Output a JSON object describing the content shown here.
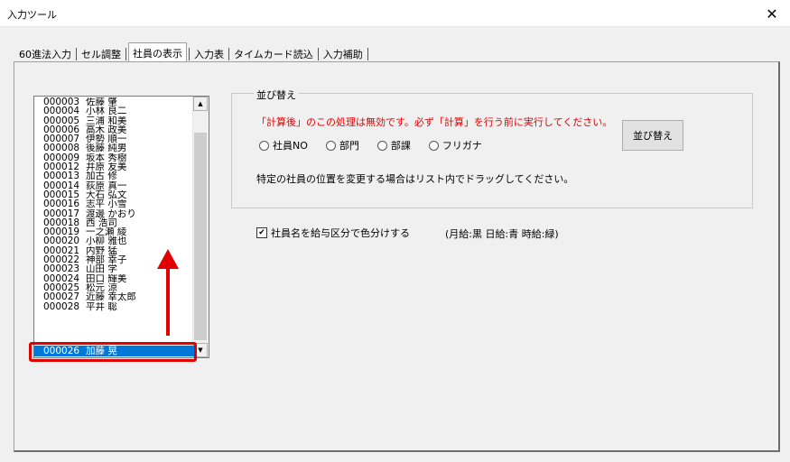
{
  "window": {
    "title": "入力ツール",
    "close_label": "✕"
  },
  "tabs": [
    "60進法入力",
    "セル調整",
    "社員の表示",
    "入力表",
    "タイムカード読込",
    "入力補助"
  ],
  "active_tab": "社員の表示",
  "employee_list": [
    {
      "code": "000003",
      "name": "佐藤 肇"
    },
    {
      "code": "000004",
      "name": "小林 良二"
    },
    {
      "code": "000005",
      "name": "三浦 和美"
    },
    {
      "code": "000006",
      "name": "高木 政美"
    },
    {
      "code": "000007",
      "name": "伊勢 順一"
    },
    {
      "code": "000008",
      "name": "後藤 純男"
    },
    {
      "code": "000009",
      "name": "坂本 秀樹"
    },
    {
      "code": "000012",
      "name": "井原 友美"
    },
    {
      "code": "000013",
      "name": "加古 修"
    },
    {
      "code": "000014",
      "name": "荻原 真一"
    },
    {
      "code": "000015",
      "name": "大石 弘文"
    },
    {
      "code": "000016",
      "name": "志平 小雪"
    },
    {
      "code": "000017",
      "name": "渡邊 かおり"
    },
    {
      "code": "000018",
      "name": "西 浩司"
    },
    {
      "code": "000019",
      "name": "一之瀬 綾"
    },
    {
      "code": "000020",
      "name": "小柳 雅也"
    },
    {
      "code": "000021",
      "name": "内野 猛"
    },
    {
      "code": "000022",
      "name": "神部 幸子"
    },
    {
      "code": "000023",
      "name": "山田 学"
    },
    {
      "code": "000024",
      "name": "田口 輝美"
    },
    {
      "code": "000025",
      "name": "松元 涼"
    },
    {
      "code": "000027",
      "name": "近藤 幸太郎"
    },
    {
      "code": "000028",
      "name": "平井 聡"
    }
  ],
  "selected_item": {
    "code": "000026",
    "name": "加藤 晃"
  },
  "sort_group": {
    "label": "並び替え",
    "warning": "「計算後」のこの処理は無効です。必ず「計算」を行う前に実行してください。",
    "options": [
      "社員NO",
      "部門",
      "部課",
      "フリガナ"
    ],
    "button": "並び替え",
    "hint": "特定の社員の位置を変更する場合はリスト内でドラッグしてください。"
  },
  "color_option": {
    "checked": true,
    "label": "社員名を給与区分で色分けする",
    "note": "(月給:黒 日給:青 時給:緑)"
  },
  "colors": {
    "accent": "#0078d7",
    "annotation": "#e00000"
  }
}
